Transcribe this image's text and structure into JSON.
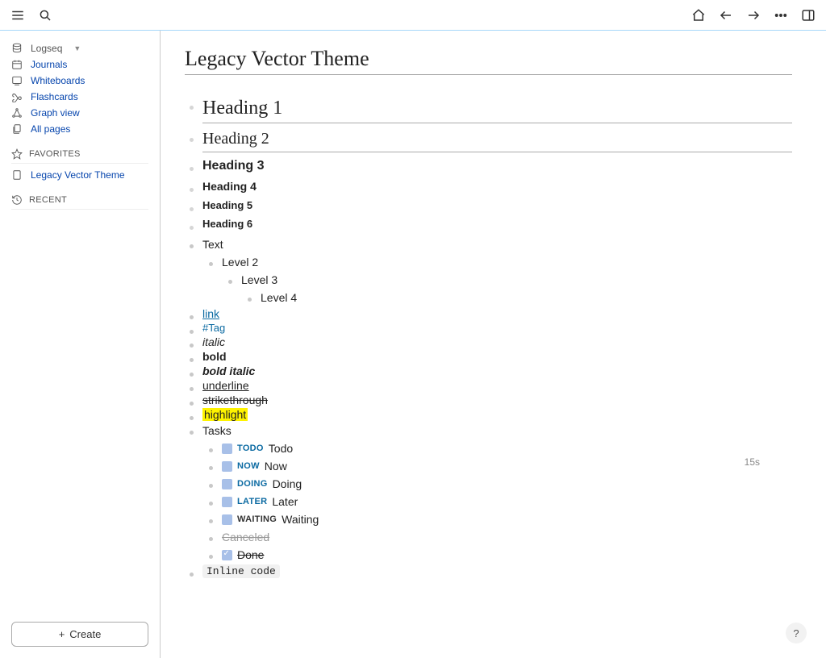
{
  "topbar": {},
  "sidebar": {
    "workspace": "Logseq",
    "nav": [
      {
        "label": "Journals",
        "icon": "calendar-icon"
      },
      {
        "label": "Whiteboards",
        "icon": "whiteboard-icon"
      },
      {
        "label": "Flashcards",
        "icon": "infinity-icon"
      },
      {
        "label": "Graph view",
        "icon": "graph-icon"
      },
      {
        "label": "All pages",
        "icon": "pages-icon"
      }
    ],
    "favorites_header": "FAVORITES",
    "favorites": [
      {
        "label": "Legacy Vector Theme"
      }
    ],
    "recent_header": "RECENT",
    "create_label": "Create"
  },
  "page": {
    "title": "Legacy Vector Theme",
    "headings": {
      "h1": "Heading 1",
      "h2": "Heading 2",
      "h3": "Heading 3",
      "h4": "Heading 4",
      "h5": "Heading 5",
      "h6": "Heading 6"
    },
    "tree": {
      "text": "Text",
      "l2": "Level 2",
      "l3": "Level 3",
      "l4": "Level 4"
    },
    "link": "link",
    "tag": "#Tag",
    "italic": "italic",
    "bold": "bold",
    "bold_italic": "bold italic",
    "underline": "underline",
    "strikethrough": "strikethrough",
    "highlight": "highlight",
    "tasks_label": "Tasks",
    "tasks": {
      "todo": {
        "state": "TODO",
        "label": "Todo",
        "time": "15s"
      },
      "now": {
        "state": "NOW",
        "label": "Now"
      },
      "doing": {
        "state": "DOING",
        "label": "Doing"
      },
      "later": {
        "state": "LATER",
        "label": "Later"
      },
      "waiting": {
        "state": "WAITING",
        "label": "Waiting"
      },
      "canceled": {
        "label": "Canceled"
      },
      "done": {
        "label": "Done"
      }
    },
    "inline_code": "Inline code"
  },
  "help": "?"
}
